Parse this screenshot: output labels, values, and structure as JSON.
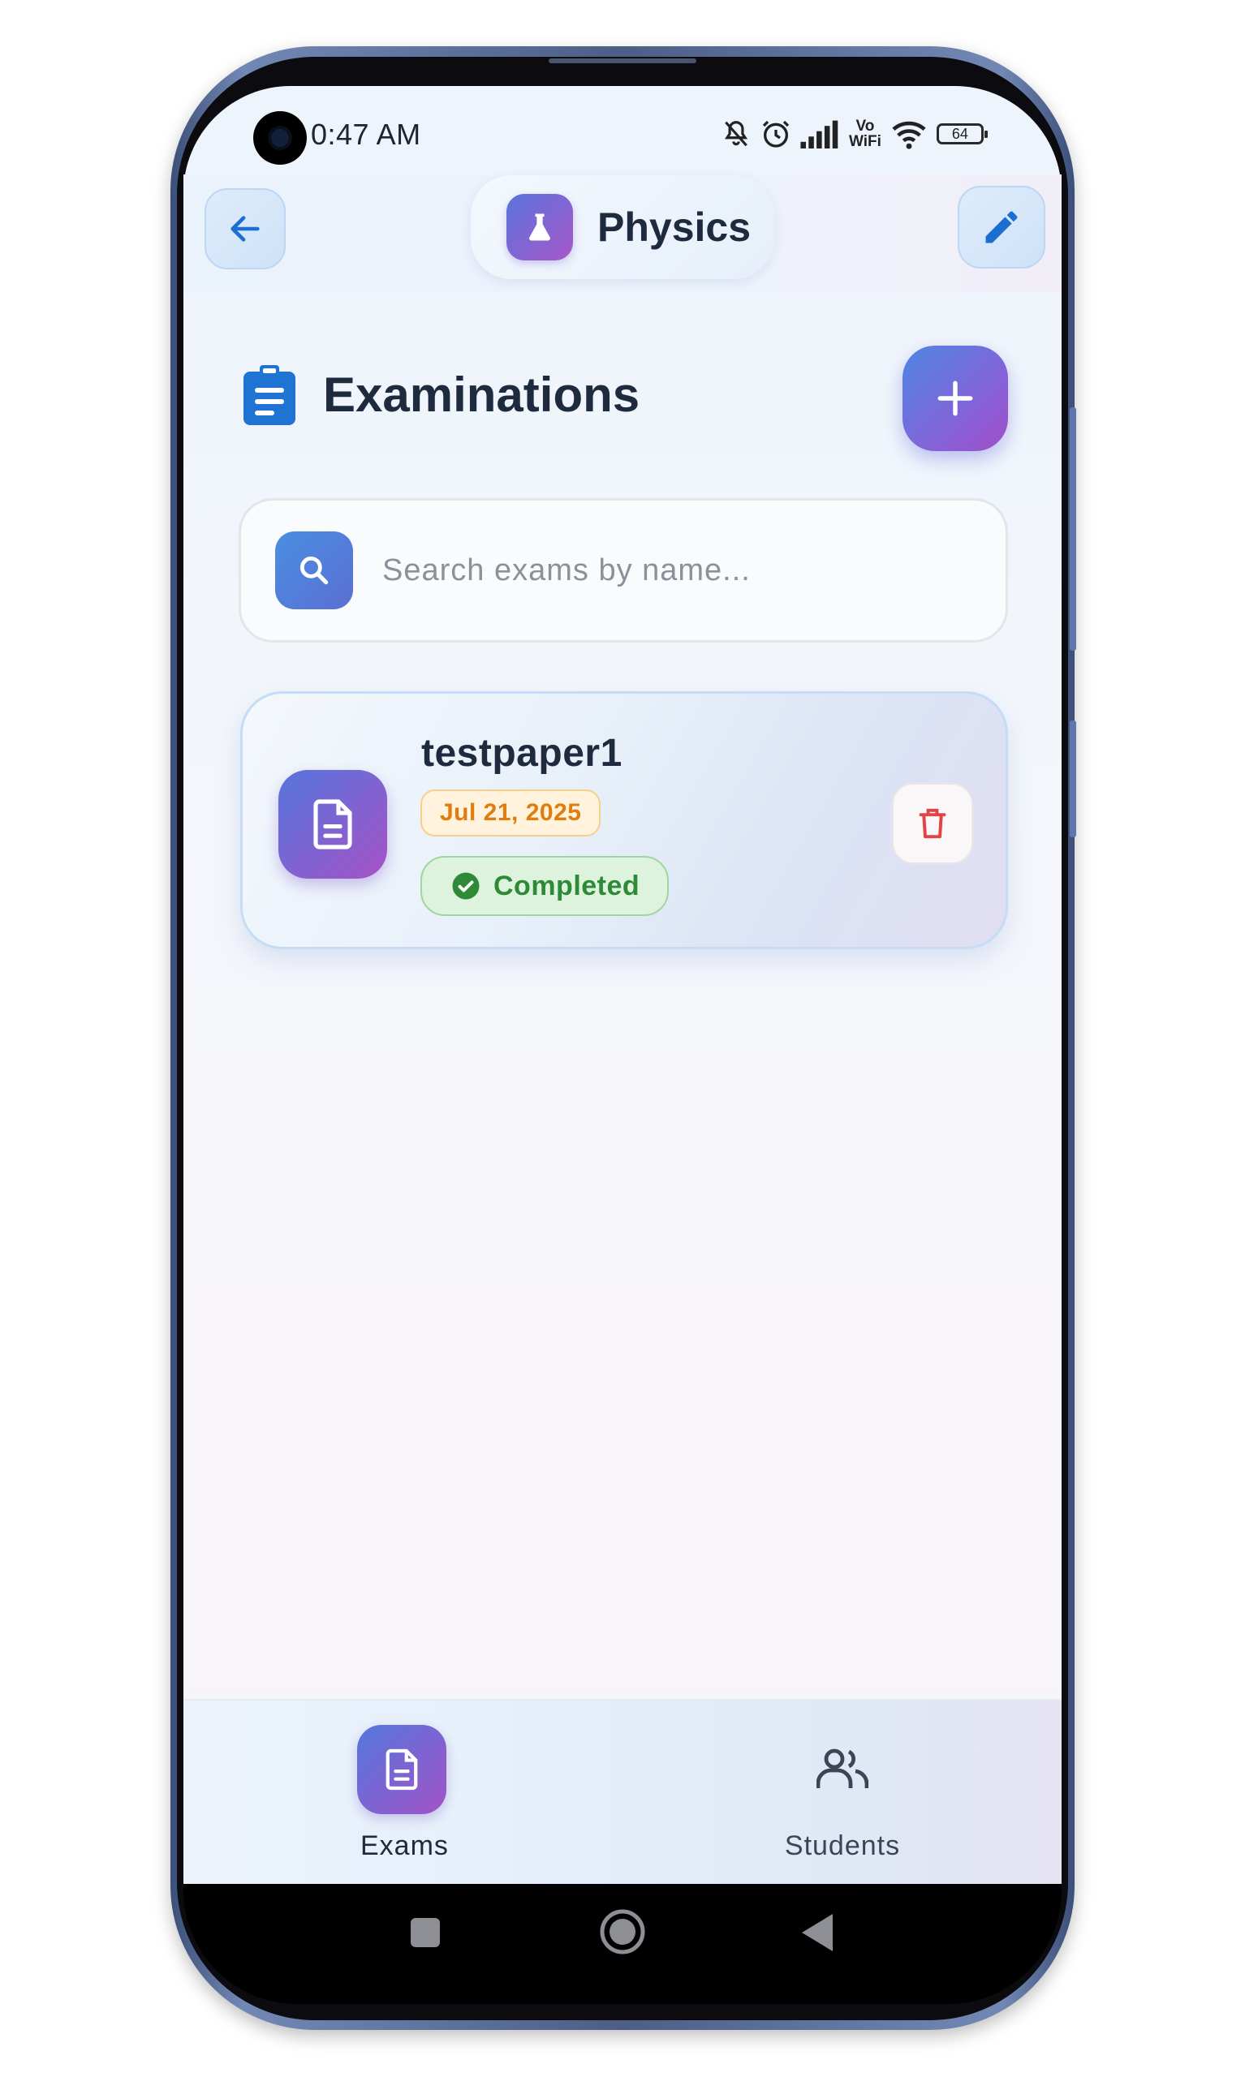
{
  "status_bar": {
    "time": "0:47 AM",
    "vo_label": "Vo",
    "wifi_label": "WiFi",
    "battery": "64"
  },
  "header": {
    "title": "Physics",
    "back_icon": "arrow-left-icon",
    "edit_icon": "pencil-icon",
    "logo_icon": "flask-icon"
  },
  "section": {
    "title": "Examinations",
    "icon": "clipboard-icon",
    "add_icon": "plus-icon"
  },
  "search": {
    "placeholder": "Search exams by name...",
    "value": ""
  },
  "exams": [
    {
      "name": "testpaper1",
      "date": "Jul 21, 2025",
      "status": "Completed",
      "status_color": "#2e8a36"
    }
  ],
  "bottom_nav": {
    "items": [
      {
        "label": "Exams",
        "icon": "document-icon",
        "active": true
      },
      {
        "label": "Students",
        "icon": "people-icon",
        "active": false
      }
    ]
  },
  "colors": {
    "accent_start": "#4f86e4",
    "accent_end": "#a04fc6",
    "title_text": "#1e2a3e",
    "date_badge": "#e07d0e",
    "delete": "#e04444"
  }
}
